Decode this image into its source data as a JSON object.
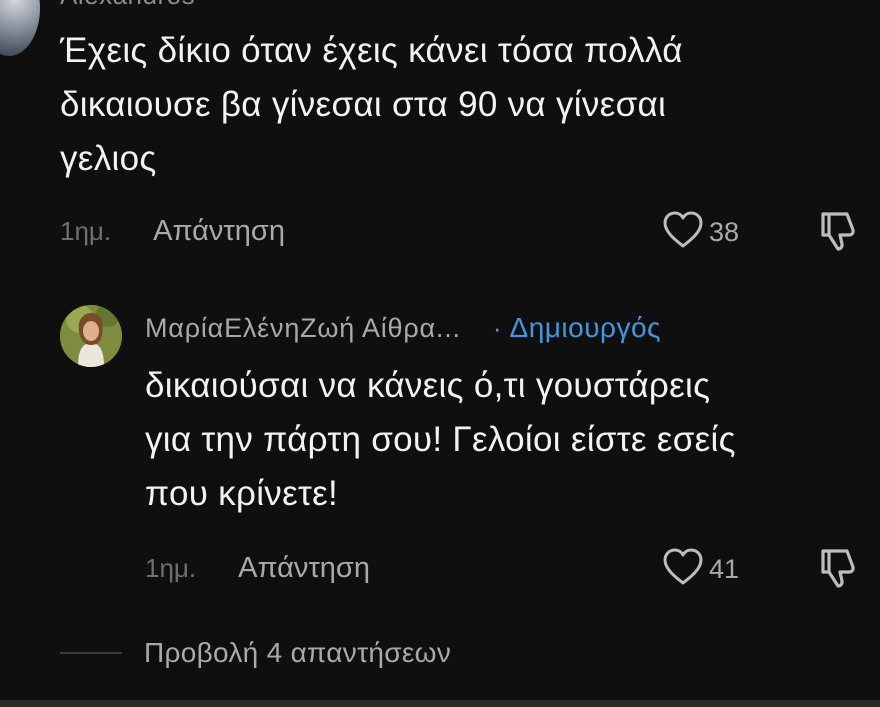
{
  "comment1": {
    "author": "Alexandros",
    "text": "Έχεις δίκιο όταν έχεις κάνει τόσα πολλά\nδικαιουσε βα γίνεσαι στα 90 να γίνεσαι\nγελιος",
    "time": "1ημ.",
    "reply_label": "Απάντηση",
    "likes": "38",
    "like_icon": "heart-outline",
    "dislike_icon": "thumbs-down-outline"
  },
  "reply1": {
    "author": "ΜαρίαΕλένηΖωή Αίθρα...",
    "separator": "·",
    "badge": "Δημιουργός",
    "text": "δικαιούσαι να κάνεις ό,τι γουστάρεις\nγια την πάρτη σου! Γελοίοι είστε εσείς\nπου κρίνετε!",
    "time": "1ημ.",
    "reply_label": "Απάντηση",
    "likes": "41",
    "like_icon": "heart-outline",
    "dislike_icon": "thumbs-down-outline"
  },
  "view_replies": {
    "label": "Προβολή 4 απαντήσεων"
  },
  "colors": {
    "background": "#0f0f0f",
    "text": "#f2f2f2",
    "muted": "#a9a9a9",
    "badge": "#3d9ae0"
  }
}
